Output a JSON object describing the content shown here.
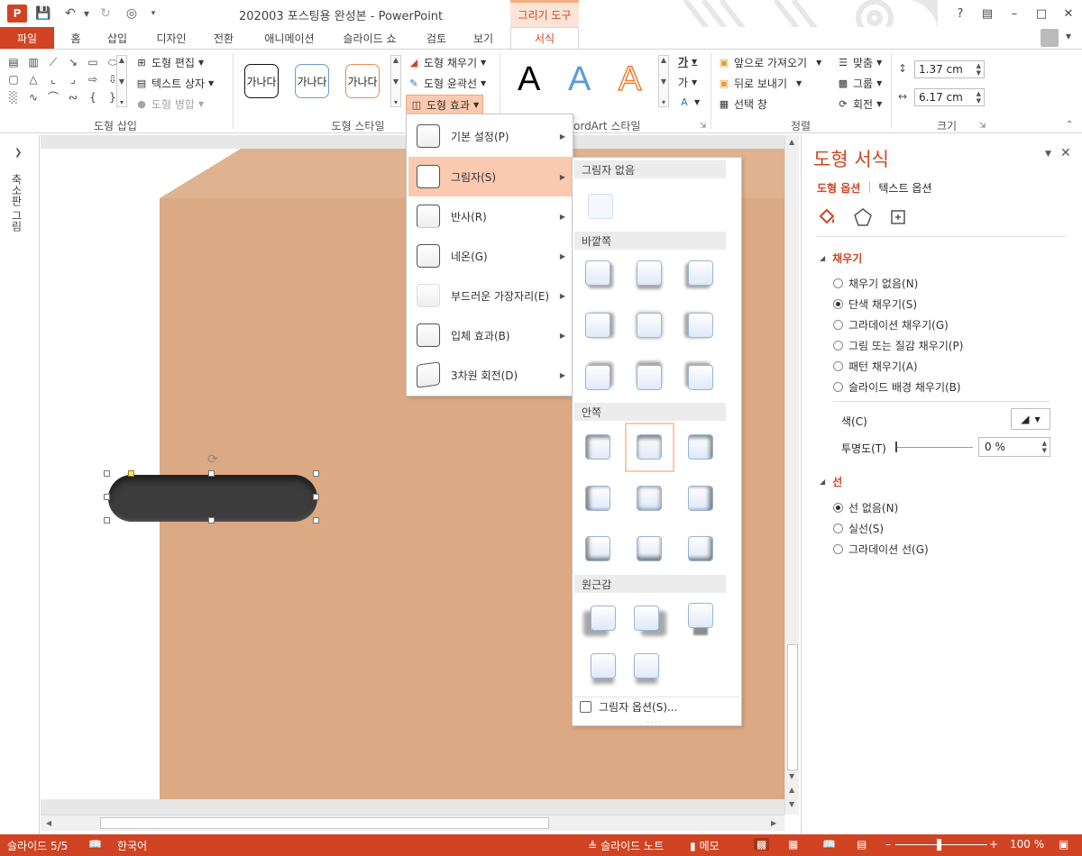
{
  "window": {
    "title": "202003 포스팅용 완성본 - PowerPoint",
    "contextual_tab_group": "그리기 도구",
    "help": "?",
    "app_logo": "P"
  },
  "tabs": [
    {
      "label": "파일"
    },
    {
      "label": "홈"
    },
    {
      "label": "삽입"
    },
    {
      "label": "디자인"
    },
    {
      "label": "전환"
    },
    {
      "label": "애니메이션"
    },
    {
      "label": "슬라이드 쇼"
    },
    {
      "label": "검토"
    },
    {
      "label": "보기"
    },
    {
      "label": "서식"
    }
  ],
  "ribbon": {
    "insert_shapes": {
      "label": "도형 삽입",
      "edit_shape": "도형 편집",
      "text_box": "텍스트 상자",
      "merge_shapes": "도형 병합"
    },
    "shape_styles": {
      "label": "도형 스타일",
      "swatch_text": "가나다",
      "fill": "도형 채우기",
      "outline": "도형 윤곽선",
      "effects": "도형 효과"
    },
    "wordart": {
      "label": "WordArt 스타일",
      "label_visible": "ordArt 스타일",
      "letter": "A",
      "text_fill_glyph": "가",
      "text_outline_glyph": "가"
    },
    "arrange": {
      "label": "정렬",
      "bring_forward": "앞으로 가져오기",
      "send_backward": "뒤로 보내기",
      "selection_pane": "선택 창",
      "align": "맞춤",
      "group": "그룹",
      "rotate": "회전"
    },
    "size": {
      "label": "크기",
      "height": "1.37 cm",
      "width": "6.17 cm"
    }
  },
  "thumbnail_pane": {
    "label": "축소판 그림"
  },
  "effects_menu": {
    "items": [
      {
        "label": "기본 설정(P)"
      },
      {
        "label": "그림자(S)"
      },
      {
        "label": "반사(R)"
      },
      {
        "label": "네온(G)"
      },
      {
        "label": "부드러운 가장자리(E)"
      },
      {
        "label": "입체 효과(B)"
      },
      {
        "label": "3차원 회전(D)"
      }
    ]
  },
  "shadow_menu": {
    "sections": {
      "none": "그림자 없음",
      "outer": "바깥쪽",
      "inner": "안쪽",
      "perspective": "원근감"
    },
    "options": "그림자 옵션(S)..."
  },
  "format_pane": {
    "title": "도형 서식",
    "tab_shape": "도형 옵션",
    "tab_text": "텍스트 옵션",
    "fill": {
      "label": "채우기",
      "options": [
        {
          "label": "채우기 없음(N)",
          "selected": false
        },
        {
          "label": "단색 채우기(S)",
          "selected": true
        },
        {
          "label": "그라데이션 채우기(G)",
          "selected": false
        },
        {
          "label": "그림 또는 질감 채우기(P)",
          "selected": false
        },
        {
          "label": "패턴 채우기(A)",
          "selected": false
        },
        {
          "label": "슬라이드 배경 채우기(B)",
          "selected": false
        }
      ],
      "color_label": "색(C)",
      "transparency_label": "투명도(T)",
      "transparency_value": "0 %"
    },
    "line": {
      "label": "선",
      "options": [
        {
          "label": "선 없음(N)",
          "selected": true
        },
        {
          "label": "실선(S)",
          "selected": false
        },
        {
          "label": "그라데이션 선(G)",
          "selected": false
        }
      ]
    }
  },
  "status": {
    "slide": "슬라이드 5/5",
    "language": "한국어",
    "notes": "슬라이드 노트",
    "comments": "메모",
    "zoom": "100 %"
  },
  "colors": {
    "accent": "#d04423",
    "wall": "#dba983",
    "wall_top": "#dfb38f",
    "shape_fill": "#3c3c3c",
    "hover": "#fbc9b0"
  }
}
